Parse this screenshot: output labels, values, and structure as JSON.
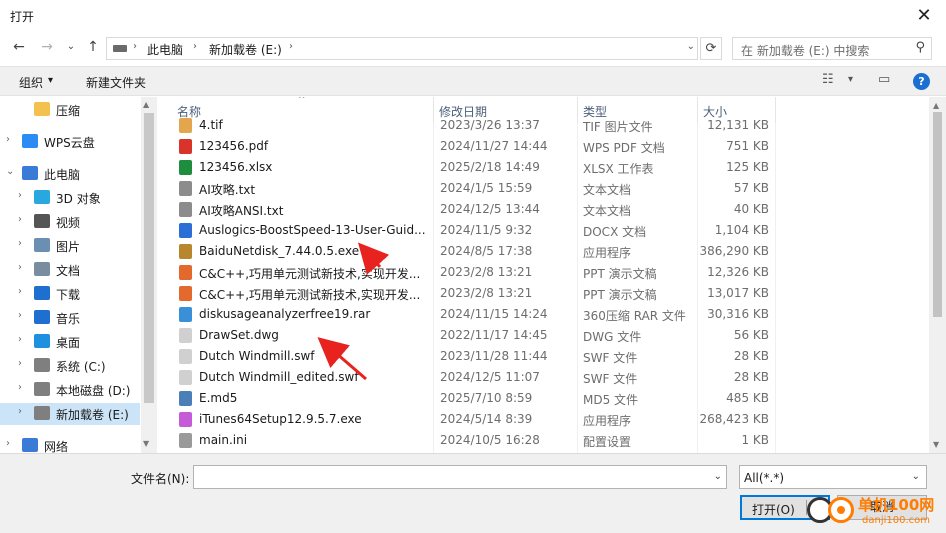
{
  "window": {
    "title": "打开",
    "close_glyph": "✕"
  },
  "nav": {
    "back_glyph": "←",
    "forward_glyph": "→",
    "recent_glyph": "⌄",
    "up_glyph": "↑",
    "breadcrumb": [
      "此电脑",
      "新加载卷 (E:)"
    ],
    "breadcrumb_sep": "›",
    "dropdown_glyph": "⌄",
    "refresh_glyph": "⟳",
    "search_placeholder": "在 新加载卷 (E:) 中搜索",
    "search_glyph": "⚲"
  },
  "toolbar": {
    "organize": "组织",
    "organize_glyph": "▾",
    "new_folder": "新建文件夹",
    "view_glyph": "☷",
    "view_dd": "▾",
    "pane_glyph": "▭",
    "help_glyph": "?"
  },
  "sidebar": {
    "items": [
      {
        "label": "压缩",
        "chev": "",
        "indent": 1,
        "color": "#f2c14e"
      },
      {
        "label": "WPS云盘",
        "chev": "›",
        "indent": 0,
        "color": "#2c8cf4"
      },
      {
        "label": "此电脑",
        "chev": "⌄",
        "indent": 0,
        "color": "#3a7bd5"
      },
      {
        "label": "3D 对象",
        "chev": "›",
        "indent": 1,
        "color": "#29a8e0"
      },
      {
        "label": "视频",
        "chev": "›",
        "indent": 1,
        "color": "#555555"
      },
      {
        "label": "图片",
        "chev": "›",
        "indent": 1,
        "color": "#6b8fb3"
      },
      {
        "label": "文档",
        "chev": "›",
        "indent": 1,
        "color": "#7a8ca0"
      },
      {
        "label": "下载",
        "chev": "›",
        "indent": 1,
        "color": "#1f6fd1"
      },
      {
        "label": "音乐",
        "chev": "›",
        "indent": 1,
        "color": "#1f6fd1"
      },
      {
        "label": "桌面",
        "chev": "›",
        "indent": 1,
        "color": "#1f8fe0"
      },
      {
        "label": "系统 (C:)",
        "chev": "›",
        "indent": 1,
        "color": "#7f7f7f"
      },
      {
        "label": "本地磁盘 (D:)",
        "chev": "›",
        "indent": 1,
        "color": "#7f7f7f"
      },
      {
        "label": "新加载卷 (E:)",
        "chev": "›",
        "indent": 1,
        "color": "#7f7f7f",
        "selected": true
      },
      {
        "label": "网络",
        "chev": "›",
        "indent": 0,
        "color": "#3a7bd5"
      }
    ]
  },
  "columns": {
    "name": "名称",
    "date": "修改日期",
    "type": "类型",
    "size": "大小",
    "sort_glyph": "^"
  },
  "files": [
    {
      "name": "4.tif",
      "date": "2023/3/26 13:37",
      "type": "TIF 图片文件",
      "size": "12,131 KB",
      "color": "#e3a64c"
    },
    {
      "name": "123456.pdf",
      "date": "2024/11/27 14:44",
      "type": "WPS PDF 文档",
      "size": "751 KB",
      "color": "#d9342b"
    },
    {
      "name": "123456.xlsx",
      "date": "2025/2/18 14:49",
      "type": "XLSX 工作表",
      "size": "125 KB",
      "color": "#1e8e3e"
    },
    {
      "name": "AI攻略.txt",
      "date": "2024/1/5 15:59",
      "type": "文本文档",
      "size": "57 KB",
      "color": "#8c8c8c"
    },
    {
      "name": "AI攻略ANSI.txt",
      "date": "2024/12/5 13:44",
      "type": "文本文档",
      "size": "40 KB",
      "color": "#8c8c8c"
    },
    {
      "name": "Auslogics-BoostSpeed-13-User-Guid...",
      "date": "2024/11/5 9:32",
      "type": "DOCX 文档",
      "size": "1,104 KB",
      "color": "#2b6fd6"
    },
    {
      "name": "BaiduNetdisk_7.44.0.5.exe",
      "date": "2024/8/5 17:38",
      "type": "应用程序",
      "size": "386,290 KB",
      "color": "#b8862d"
    },
    {
      "name": "C&C++,巧用单元测试新技术,实现开发...",
      "date": "2023/2/8 13:21",
      "type": "PPT 演示文稿",
      "size": "12,326 KB",
      "color": "#e36a2c"
    },
    {
      "name": "C&C++,巧用单元测试新技术,实现开发...",
      "date": "2023/2/8 13:21",
      "type": "PPT 演示文稿",
      "size": "13,017 KB",
      "color": "#e36a2c"
    },
    {
      "name": "diskusageanalyzerfree19.rar",
      "date": "2024/11/15 14:24",
      "type": "360压缩 RAR 文件",
      "size": "30,316 KB",
      "color": "#3a8fd9"
    },
    {
      "name": "DrawSet.dwg",
      "date": "2022/11/17 14:45",
      "type": "DWG 文件",
      "size": "56 KB",
      "color": "#d0d0d0"
    },
    {
      "name": "Dutch Windmill.swf",
      "date": "2023/11/28 11:44",
      "type": "SWF 文件",
      "size": "28 KB",
      "color": "#d0d0d0"
    },
    {
      "name": "Dutch Windmill_edited.swf",
      "date": "2024/12/5 11:07",
      "type": "SWF 文件",
      "size": "28 KB",
      "color": "#d0d0d0"
    },
    {
      "name": "E.md5",
      "date": "2025/7/10 8:59",
      "type": "MD5 文件",
      "size": "485 KB",
      "color": "#4a7fb8"
    },
    {
      "name": "iTunes64Setup12.9.5.7.exe",
      "date": "2024/5/14 8:39",
      "type": "应用程序",
      "size": "268,423 KB",
      "color": "#c65bd8"
    },
    {
      "name": "main.ini",
      "date": "2024/10/5 16:28",
      "type": "配置设置",
      "size": "1 KB",
      "color": "#9a9a9a"
    }
  ],
  "bottom": {
    "filename_label": "文件名(N):",
    "filename_value": "",
    "filter_value": "All(*.*)",
    "dd_glyph": "⌄",
    "open_label": "打开(O)",
    "open_dd_glyph": "▾",
    "cancel_label": "取消"
  },
  "watermark": {
    "site": "单机100网",
    "url": "danji100.com"
  },
  "colors": {
    "accent": "#0078d7",
    "selection": "#cce4f7",
    "annotation": "#e8231f"
  }
}
